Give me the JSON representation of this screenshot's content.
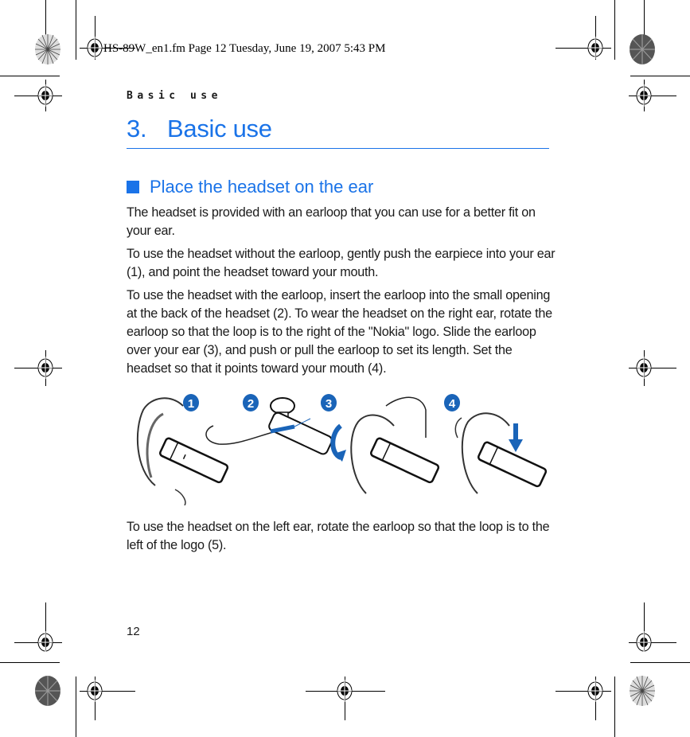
{
  "print_slug": "HS-89W_en1.fm  Page 12  Tuesday, June 19, 2007  5:43 PM",
  "running_header": "Basic use",
  "chapter": {
    "number": "3.",
    "title": "Basic use"
  },
  "section": {
    "title": "Place the headset on the ear"
  },
  "paragraphs": [
    "The headset is provided with an earloop that you can use for a better fit on your ear.",
    "To use the headset without the earloop, gently push the earpiece into your ear (1), and point the headset toward your mouth.",
    "To use the headset with the earloop, insert the earloop into the small opening at the back of the headset (2). To wear the headset on the right ear, rotate the earloop so that the loop is to the right of the \"Nokia\" logo. Slide the earloop over your ear (3), and push or pull the earloop to set its length. Set the headset so that it points toward your mouth (4).",
    "To use the headset on the left ear, rotate the earloop so that the loop is to the left of the logo (5)."
  ],
  "figure": {
    "steps": [
      {
        "label": "1",
        "caption_icon": "headset-in-ear"
      },
      {
        "label": "2",
        "caption_icon": "earloop-insert"
      },
      {
        "label": "3",
        "caption_icon": "earloop-over-ear-rotate"
      },
      {
        "label": "4",
        "caption_icon": "headset-adjust-down"
      }
    ],
    "accent_color": "#1a64b8"
  },
  "page_number": "12",
  "colors": {
    "heading": "#1a73e8",
    "text": "#1a1a1a",
    "step_badge": "#1a64b8"
  }
}
